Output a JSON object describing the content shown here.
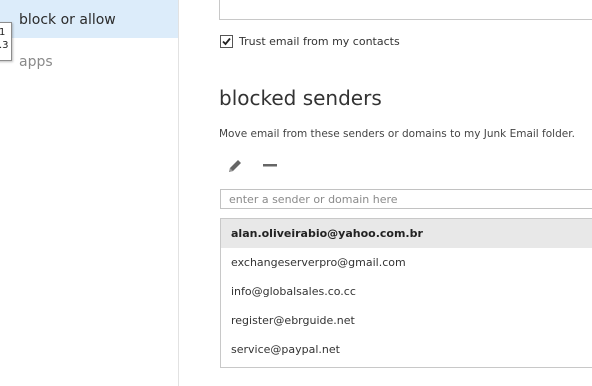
{
  "sidebar": {
    "items": [
      {
        "label": "block or allow",
        "selected": true
      },
      {
        "label": "apps",
        "selected": false
      }
    ],
    "tooltip_lines": [
      "1",
      ".3"
    ]
  },
  "options": {
    "trust_contacts_label": "Trust email from my contacts",
    "trust_contacts_checked": true
  },
  "blocked_senders": {
    "title": "blocked senders",
    "description": "Move email from these senders or domains to my Junk Email folder.",
    "input_placeholder": "enter a sender or domain here",
    "entries": [
      "alan.oliveirabio@yahoo.com.br",
      "exchangeserverpro@gmail.com",
      "info@globalsales.co.cc",
      "register@ebrguide.net",
      "service@paypal.net"
    ],
    "selected_index": 0
  },
  "icons": {
    "edit": "pencil-icon",
    "remove": "minus-icon",
    "check": "checkmark-icon"
  },
  "colors": {
    "selected_nav_bg": "#dcecfa",
    "selected_row_bg": "#e8e8e8"
  }
}
